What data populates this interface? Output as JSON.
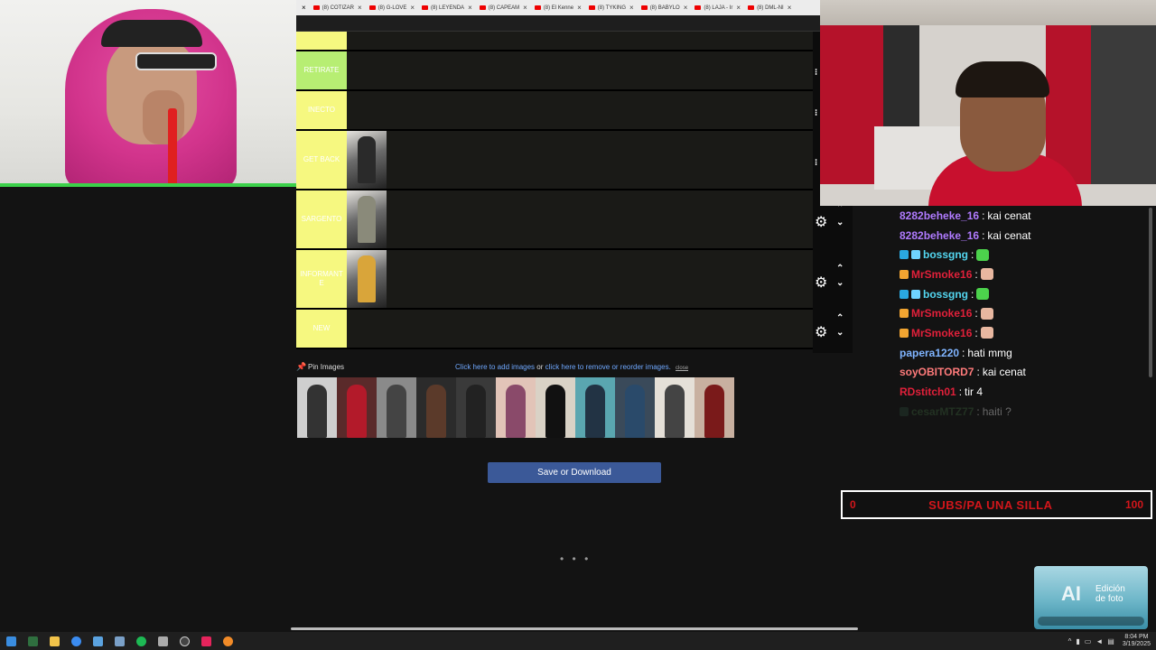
{
  "browser": {
    "tabs": [
      {
        "label": "(8) COTIZAR"
      },
      {
        "label": "(8) G-LOVE"
      },
      {
        "label": "(8) LEYENDA"
      },
      {
        "label": "(8) CAPEAM"
      },
      {
        "label": "(8) El Kenne"
      },
      {
        "label": "(8) TYKING"
      },
      {
        "label": "(8) BABYLO"
      },
      {
        "label": "(8) LAJA - Ir"
      },
      {
        "label": "(8) DML-NI"
      }
    ],
    "tab_close": "×"
  },
  "tierlist": {
    "tiers": [
      {
        "label": "RETIRATE",
        "color": "#b7ee73",
        "has_image": false
      },
      {
        "label": "INECTO",
        "color": "#f6f880",
        "has_image": false
      },
      {
        "label": "GET BACK",
        "color": "#f6f880",
        "has_image": true
      },
      {
        "label": "SARGENTO",
        "color": "#f6f880",
        "has_image": true
      },
      {
        "label": "INFORMANT E",
        "color": "#f6f880",
        "has_image": true
      },
      {
        "label": "NEW",
        "color": "#f6f880",
        "has_image": false
      }
    ]
  },
  "pin": {
    "label": "Pin Images",
    "add_link": "Click here to add images",
    "or": "or",
    "reorder_link": "click here to remove or reorder images.",
    "close": "close"
  },
  "save_button": "Save or Download",
  "loading_dots": "• • •",
  "chat": {
    "messages": [
      {
        "user": "8282beheke_16",
        "color": "#b07bff",
        "sep": ":",
        "text": "kai cenat",
        "badges": [],
        "emote": ""
      },
      {
        "user": "8282beheke_16",
        "color": "#b07bff",
        "sep": ":",
        "text": "kai cenat",
        "badges": [],
        "emote": ""
      },
      {
        "user": "bossgng",
        "color": "#53d6f0",
        "sep": ":",
        "text": "",
        "badges": [
          "#2aa8e0",
          "#6fd3ff"
        ],
        "emote": "#4cd24c"
      },
      {
        "user": "MrSmoke16",
        "color": "#e0203a",
        "sep": ":",
        "text": "",
        "badges": [
          "#f2a531"
        ],
        "emote": "#e8b7a0"
      },
      {
        "user": "bossgng",
        "color": "#53d6f0",
        "sep": ":",
        "text": "",
        "badges": [
          "#2aa8e0",
          "#6fd3ff"
        ],
        "emote": "#4cd24c"
      },
      {
        "user": "MrSmoke16",
        "color": "#e0203a",
        "sep": ":",
        "text": "",
        "badges": [
          "#f2a531"
        ],
        "emote": "#e8b7a0"
      },
      {
        "user": "MrSmoke16",
        "color": "#e0203a",
        "sep": ":",
        "text": "",
        "badges": [
          "#f2a531"
        ],
        "emote": "#e8b7a0"
      },
      {
        "user": "papera1220",
        "color": "#7fb4ff",
        "sep": ":",
        "text": "hati mmg",
        "badges": [],
        "emote": ""
      },
      {
        "user": "soyOBITORD7",
        "color": "#ff7b7b",
        "sep": ":",
        "text": "kai cenat",
        "badges": [],
        "emote": ""
      },
      {
        "user": "RDstitch01",
        "color": "#e0203a",
        "sep": ":",
        "text": "tir 4",
        "badges": [],
        "emote": ""
      },
      {
        "user": "cesarMTZ77",
        "color": "#3f6a3f",
        "sep": ":",
        "text": "haiti ?",
        "badges": [
          "#2c4a3a"
        ],
        "emote": ""
      }
    ]
  },
  "goal": {
    "start": "0",
    "title": "SUBS/PA UNA SILLA",
    "end": "100"
  },
  "ad": {
    "big": "AI",
    "text_line1": "Edición",
    "text_line2": "de foto"
  },
  "taskbar": {
    "time": "8:04 PM",
    "date": "3/19/2025"
  },
  "colors": {
    "save_button": "#3b5998",
    "goal_text": "#d3161b",
    "link": "#6fa8ff"
  }
}
